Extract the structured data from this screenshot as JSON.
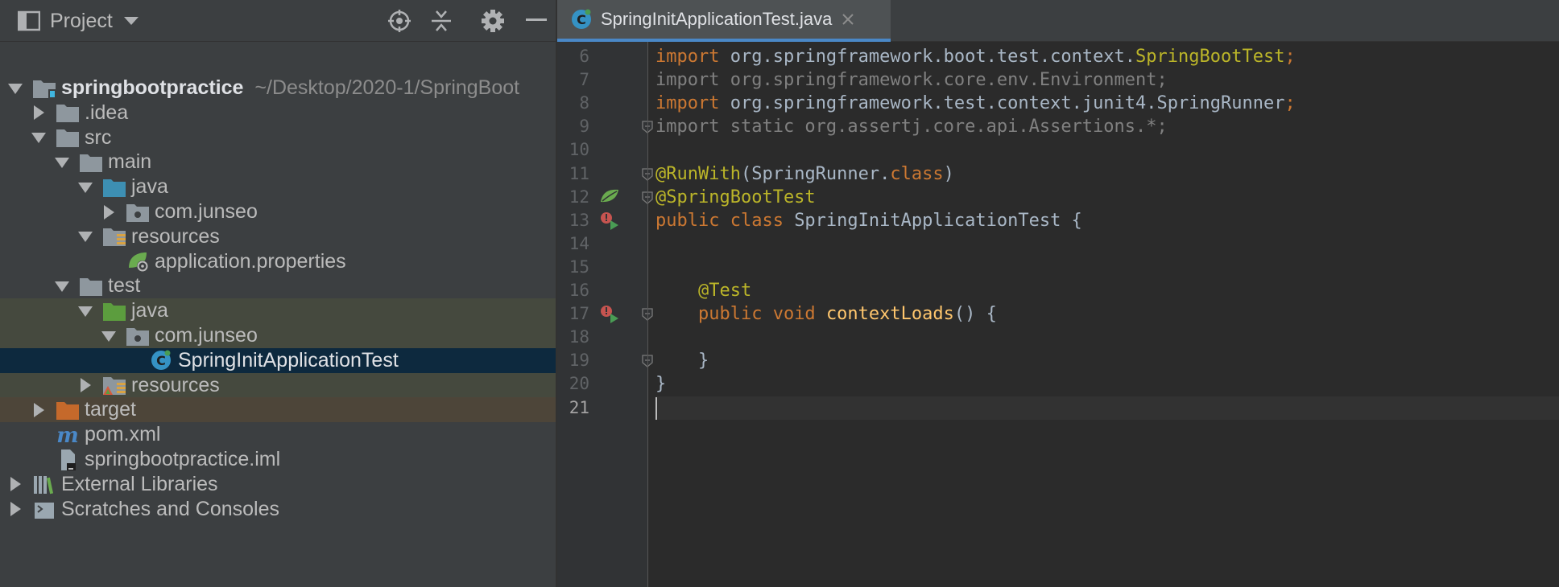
{
  "project_panel": {
    "title": "Project",
    "toolbar_icons": [
      "locate-icon",
      "collapse-all-icon",
      "gear-icon",
      "hide-icon"
    ],
    "tree": [
      {
        "name": "springbootpractice",
        "detail": "~/Desktop/2020-1/SpringBoot",
        "depth": 0,
        "expanded": true,
        "icon": "module-folder-icon",
        "bold": true
      },
      {
        "name": ".idea",
        "depth": 1,
        "expanded": false,
        "icon": "folder-icon"
      },
      {
        "name": "src",
        "depth": 1,
        "expanded": true,
        "icon": "folder-icon"
      },
      {
        "name": "main",
        "depth": 2,
        "expanded": true,
        "icon": "folder-icon"
      },
      {
        "name": "java",
        "depth": 3,
        "expanded": true,
        "icon": "source-folder-icon"
      },
      {
        "name": "com.junseo",
        "depth": 4,
        "expanded": false,
        "icon": "package-icon"
      },
      {
        "name": "resources",
        "depth": 3,
        "expanded": true,
        "icon": "resources-folder-icon"
      },
      {
        "name": "application.properties",
        "depth": 4,
        "leaf": true,
        "icon": "spring-properties-icon"
      },
      {
        "name": "test",
        "depth": 2,
        "expanded": true,
        "icon": "folder-icon"
      },
      {
        "name": "java",
        "depth": 3,
        "expanded": true,
        "icon": "test-source-folder-icon",
        "highlight": "green"
      },
      {
        "name": "com.junseo",
        "depth": 4,
        "expanded": true,
        "icon": "package-icon",
        "highlight": "green"
      },
      {
        "name": "SpringInitApplicationTest",
        "depth": 5,
        "leaf": true,
        "icon": "java-class-icon",
        "selected": true
      },
      {
        "name": "resources",
        "depth": 3,
        "expanded": false,
        "icon": "test-resources-folder-icon",
        "highlight": "green"
      },
      {
        "name": "target",
        "depth": 1,
        "expanded": false,
        "icon": "excluded-folder-icon",
        "highlight": "brown"
      },
      {
        "name": "pom.xml",
        "depth": 1,
        "leaf": true,
        "icon": "maven-icon"
      },
      {
        "name": "springbootpractice.iml",
        "depth": 1,
        "leaf": true,
        "icon": "iml-file-icon"
      },
      {
        "name": "External Libraries",
        "depth": 0,
        "expanded": false,
        "icon": "libraries-icon"
      },
      {
        "name": "Scratches and Consoles",
        "depth": 0,
        "expanded": false,
        "icon": "scratches-icon"
      }
    ]
  },
  "editor": {
    "tab": {
      "label": "SpringInitApplicationTest.java",
      "icon": "java-class-icon"
    },
    "current_line": 21,
    "lines": [
      {
        "n": "6",
        "tokens": [
          [
            "kw",
            "import"
          ],
          [
            "pl",
            " org.springframework.boot.test.context."
          ],
          [
            "ann",
            "SpringBootTest"
          ],
          [
            "kw",
            ";"
          ]
        ]
      },
      {
        "n": "7",
        "tokens": [
          [
            "dim",
            "import org.springframework.core.env.Environment;"
          ]
        ]
      },
      {
        "n": "8",
        "tokens": [
          [
            "kw",
            "import"
          ],
          [
            "pl",
            " org.springframework.test.context.junit4.SpringRunner"
          ],
          [
            "kw",
            ";"
          ]
        ]
      },
      {
        "n": "9",
        "fold": true,
        "tokens": [
          [
            "dim",
            "import static org.assertj.core.api.Assertions.*;"
          ]
        ]
      },
      {
        "n": "10",
        "tokens": []
      },
      {
        "n": "11",
        "fold": true,
        "tokens": [
          [
            "ann",
            "@RunWith"
          ],
          [
            "pl",
            "(SpringRunner."
          ],
          [
            "kw",
            "class"
          ],
          [
            "pl",
            ")"
          ]
        ]
      },
      {
        "n": "12",
        "fold": true,
        "gutter": "spring-bean-icon",
        "tokens": [
          [
            "ann",
            "@SpringBootTest"
          ]
        ]
      },
      {
        "n": "13",
        "gutter": "run-test-icon",
        "tokens": [
          [
            "kw",
            "public class "
          ],
          [
            "pl",
            "SpringInitApplicationTest {"
          ]
        ]
      },
      {
        "n": "14",
        "tokens": []
      },
      {
        "n": "15",
        "tokens": []
      },
      {
        "n": "16",
        "tokens": [
          [
            "pl",
            "    "
          ],
          [
            "ann",
            "@Test"
          ]
        ]
      },
      {
        "n": "17",
        "fold": true,
        "gutter": "run-test-icon",
        "tokens": [
          [
            "pl",
            "    "
          ],
          [
            "kw",
            "public void "
          ],
          [
            "fn",
            "contextLoads"
          ],
          [
            "pl",
            "() {"
          ]
        ]
      },
      {
        "n": "18",
        "tokens": []
      },
      {
        "n": "19",
        "fold": true,
        "tokens": [
          [
            "pl",
            "    }"
          ]
        ]
      },
      {
        "n": "20",
        "tokens": [
          [
            "pl",
            "}"
          ]
        ]
      },
      {
        "n": "21",
        "tokens": []
      }
    ]
  },
  "colors": {
    "selection": "#0d293e",
    "test_highlight": "#45493e",
    "excluded_highlight": "#4d4539",
    "keyword": "#cc7832",
    "annotation": "#bbb529",
    "function": "#ffc66d",
    "tab_underline": "#4a88c7"
  }
}
